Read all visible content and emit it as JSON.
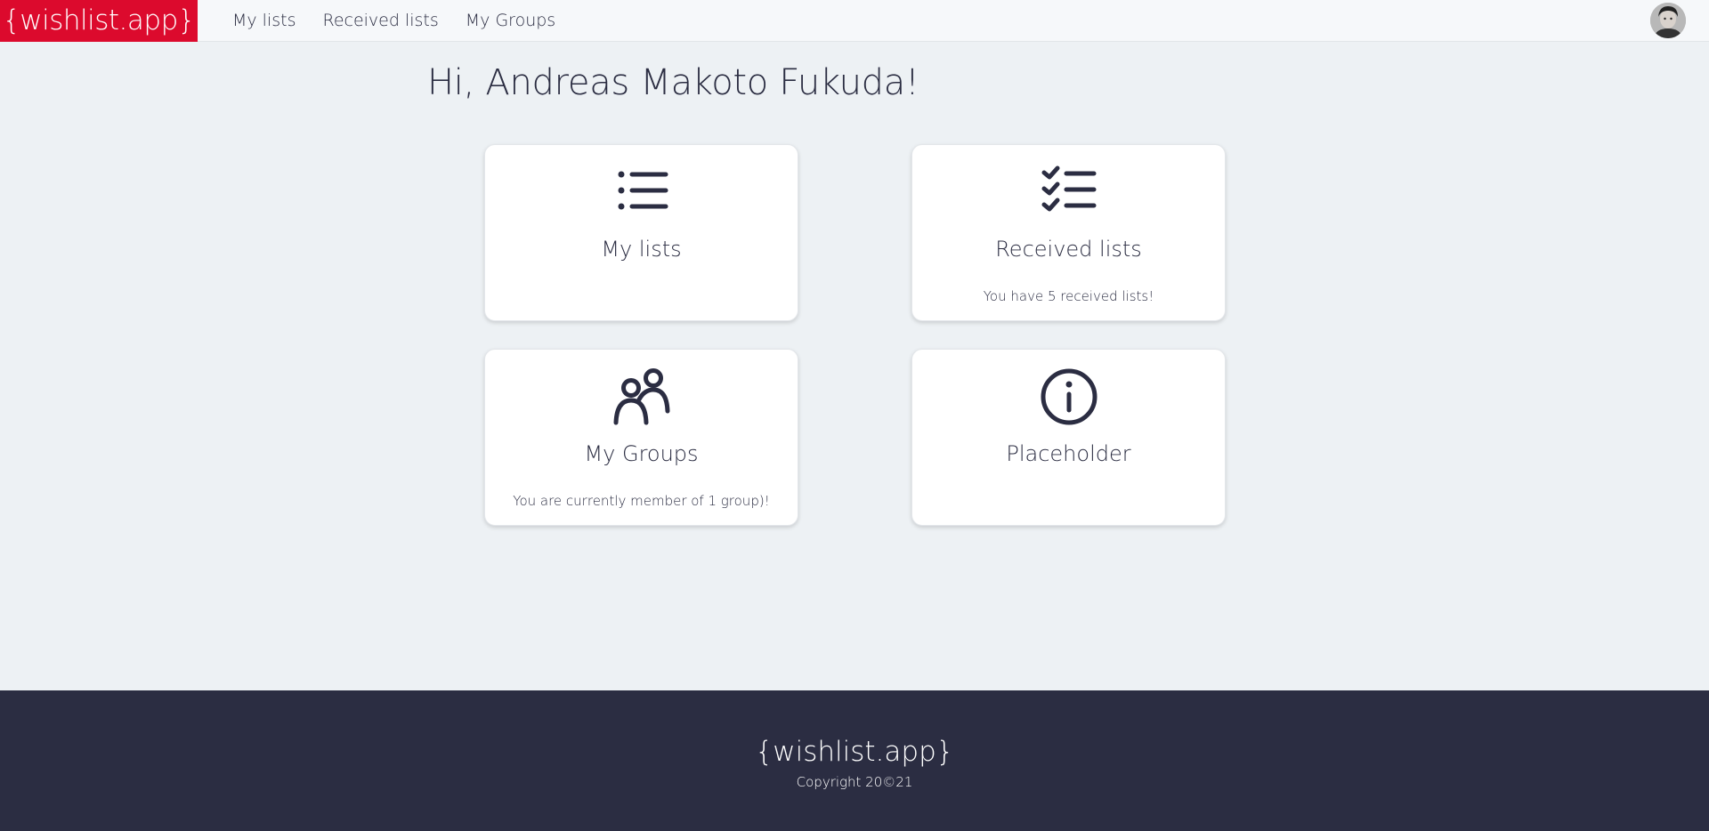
{
  "header": {
    "brand": "{wishlist.app}",
    "nav": [
      {
        "label": "My lists"
      },
      {
        "label": "Received lists"
      },
      {
        "label": "My Groups"
      }
    ]
  },
  "main": {
    "greeting": "Hi, Andreas Makoto Fukuda!",
    "cards": [
      {
        "title": "My lists",
        "subtitle": "",
        "icon": "list-icon"
      },
      {
        "title": "Received lists",
        "subtitle": "You have 5 received lists!",
        "icon": "checklist-icon"
      },
      {
        "title": "My Groups",
        "subtitle": "You are currently member of 1 group)!",
        "icon": "users-icon"
      },
      {
        "title": "Placeholder",
        "subtitle": "",
        "icon": "info-icon"
      }
    ]
  },
  "footer": {
    "brand": "{wishlist.app}",
    "copyright": "Copyright 20©21"
  },
  "colors": {
    "brand_red": "#dc0a2d",
    "dark_navy": "#2b2d42",
    "page_bg": "#edf1f4"
  }
}
